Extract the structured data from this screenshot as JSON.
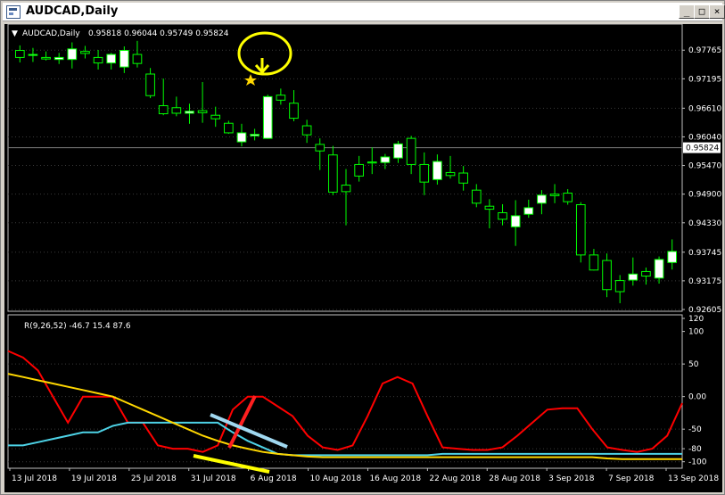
{
  "window": {
    "title": "AUDCAD,Daily",
    "buttons": {
      "minimize": "_",
      "maximize": "□",
      "close": "×"
    }
  },
  "colors": {
    "background": "#000000",
    "bull_candle": "#ffffff",
    "wick": "#00ff00",
    "grid": "#3a3a3a",
    "osc_red": "#ff0000",
    "osc_cyan": "#4dd2e6",
    "osc_yellow": "#ffd700",
    "annotation_yellow": "#ffff00",
    "annotation_red": "#ff2020",
    "annotation_lightblue": "#a0d8f0"
  },
  "chart_data": [
    {
      "type": "candlestick",
      "title": "AUDCAD,Daily",
      "ohlc_header": "0.95818 0.96044 0.95749 0.95824",
      "current_price": 0.95824,
      "current_price_label": "0.95824",
      "ylim": [
        0.92605,
        0.98
      ],
      "y_ticks": [
        "0.97765",
        "0.97195",
        "0.96610",
        "0.96040",
        "0.95470",
        "0.94900",
        "0.94330",
        "0.93745",
        "0.93175",
        "0.92605"
      ],
      "x_ticks": [
        "13 Jul 2018",
        "19 Jul 2018",
        "25 Jul 2018",
        "31 Jul 2018",
        "6 Aug 2018",
        "10 Aug 2018",
        "16 Aug 2018",
        "22 Aug 2018",
        "28 Aug 2018",
        "3 Sep 2018",
        "7 Sep 2018",
        "13 Sep 2018"
      ],
      "candles": [
        {
          "o": 0.9776,
          "h": 0.9786,
          "l": 0.9752,
          "c": 0.9762
        },
        {
          "o": 0.9766,
          "h": 0.9781,
          "l": 0.9753,
          "c": 0.9768
        },
        {
          "o": 0.9762,
          "h": 0.9774,
          "l": 0.9756,
          "c": 0.9759
        },
        {
          "o": 0.9758,
          "h": 0.9771,
          "l": 0.9749,
          "c": 0.9762
        },
        {
          "o": 0.9758,
          "h": 0.9792,
          "l": 0.974,
          "c": 0.9779
        },
        {
          "o": 0.9774,
          "h": 0.9785,
          "l": 0.976,
          "c": 0.977
        },
        {
          "o": 0.9762,
          "h": 0.9777,
          "l": 0.9738,
          "c": 0.9751
        },
        {
          "o": 0.9751,
          "h": 0.9771,
          "l": 0.9738,
          "c": 0.9768
        },
        {
          "o": 0.9743,
          "h": 0.9784,
          "l": 0.9731,
          "c": 0.9776
        },
        {
          "o": 0.9768,
          "h": 0.9795,
          "l": 0.9742,
          "c": 0.975
        },
        {
          "o": 0.9729,
          "h": 0.9741,
          "l": 0.9681,
          "c": 0.9686
        },
        {
          "o": 0.9666,
          "h": 0.972,
          "l": 0.9647,
          "c": 0.965
        },
        {
          "o": 0.9662,
          "h": 0.9684,
          "l": 0.9645,
          "c": 0.9651
        },
        {
          "o": 0.9651,
          "h": 0.967,
          "l": 0.963,
          "c": 0.9655
        },
        {
          "o": 0.9656,
          "h": 0.9713,
          "l": 0.9632,
          "c": 0.9652
        },
        {
          "o": 0.9647,
          "h": 0.9664,
          "l": 0.9624,
          "c": 0.964
        },
        {
          "o": 0.9631,
          "h": 0.9636,
          "l": 0.961,
          "c": 0.9612
        },
        {
          "o": 0.9594,
          "h": 0.963,
          "l": 0.9585,
          "c": 0.9612
        },
        {
          "o": 0.9606,
          "h": 0.962,
          "l": 0.9597,
          "c": 0.9609
        },
        {
          "o": 0.9601,
          "h": 0.9688,
          "l": 0.96,
          "c": 0.9684
        },
        {
          "o": 0.9687,
          "h": 0.97,
          "l": 0.9668,
          "c": 0.9677
        },
        {
          "o": 0.9671,
          "h": 0.9697,
          "l": 0.9635,
          "c": 0.9641
        },
        {
          "o": 0.9626,
          "h": 0.9638,
          "l": 0.9592,
          "c": 0.9608
        },
        {
          "o": 0.9589,
          "h": 0.9601,
          "l": 0.9538,
          "c": 0.9576
        },
        {
          "o": 0.9568,
          "h": 0.9586,
          "l": 0.9488,
          "c": 0.9494
        },
        {
          "o": 0.9508,
          "h": 0.954,
          "l": 0.9428,
          "c": 0.9495
        },
        {
          "o": 0.9549,
          "h": 0.9566,
          "l": 0.9515,
          "c": 0.9526
        },
        {
          "o": 0.9554,
          "h": 0.9583,
          "l": 0.953,
          "c": 0.9552
        },
        {
          "o": 0.9553,
          "h": 0.957,
          "l": 0.954,
          "c": 0.9564
        },
        {
          "o": 0.9562,
          "h": 0.9596,
          "l": 0.9552,
          "c": 0.959
        },
        {
          "o": 0.9601,
          "h": 0.9606,
          "l": 0.953,
          "c": 0.9549
        },
        {
          "o": 0.9549,
          "h": 0.9573,
          "l": 0.9488,
          "c": 0.9514
        },
        {
          "o": 0.9519,
          "h": 0.9569,
          "l": 0.9509,
          "c": 0.9555
        },
        {
          "o": 0.9533,
          "h": 0.9566,
          "l": 0.9521,
          "c": 0.9527
        },
        {
          "o": 0.9532,
          "h": 0.9546,
          "l": 0.9497,
          "c": 0.9512
        },
        {
          "o": 0.9498,
          "h": 0.951,
          "l": 0.9464,
          "c": 0.9472
        },
        {
          "o": 0.9466,
          "h": 0.948,
          "l": 0.9422,
          "c": 0.946
        },
        {
          "o": 0.9453,
          "h": 0.947,
          "l": 0.9428,
          "c": 0.944
        },
        {
          "o": 0.9425,
          "h": 0.9478,
          "l": 0.9387,
          "c": 0.9447
        },
        {
          "o": 0.945,
          "h": 0.9479,
          "l": 0.9443,
          "c": 0.9463
        },
        {
          "o": 0.9472,
          "h": 0.9498,
          "l": 0.945,
          "c": 0.9488
        },
        {
          "o": 0.949,
          "h": 0.951,
          "l": 0.9472,
          "c": 0.9487
        },
        {
          "o": 0.9492,
          "h": 0.95,
          "l": 0.9469,
          "c": 0.9475
        },
        {
          "o": 0.9469,
          "h": 0.9474,
          "l": 0.9354,
          "c": 0.9369
        },
        {
          "o": 0.9369,
          "h": 0.9381,
          "l": 0.9338,
          "c": 0.9339
        },
        {
          "o": 0.9358,
          "h": 0.9372,
          "l": 0.9285,
          "c": 0.93
        },
        {
          "o": 0.9318,
          "h": 0.9329,
          "l": 0.9273,
          "c": 0.9296
        },
        {
          "o": 0.9319,
          "h": 0.9364,
          "l": 0.9308,
          "c": 0.9331
        },
        {
          "o": 0.9336,
          "h": 0.9344,
          "l": 0.931,
          "c": 0.9327
        },
        {
          "o": 0.9323,
          "h": 0.9366,
          "l": 0.9312,
          "c": 0.936
        },
        {
          "o": 0.9354,
          "h": 0.94,
          "l": 0.934,
          "c": 0.9376
        }
      ]
    },
    {
      "type": "line",
      "title": "R(9,26,52) -46.7 15.4 87.6",
      "ylim": [
        -100,
        100
      ],
      "y_ticks": [
        "120",
        "100",
        "50",
        "0.00",
        "-50",
        "-80",
        "-100"
      ],
      "series": [
        {
          "color": "#ff0000",
          "values": [
            70,
            60,
            40,
            0,
            -40,
            0,
            0,
            0,
            -40,
            -40,
            -75,
            -80,
            -80,
            -85,
            -75,
            -20,
            0,
            0,
            -15,
            -30,
            -60,
            -78,
            -82,
            -75,
            -30,
            20,
            30,
            20,
            -30,
            -78,
            -80,
            -82,
            -82,
            -78,
            -60,
            -40,
            -20,
            -18,
            -18,
            -50,
            -78,
            -82,
            -85,
            -80,
            -60,
            -10
          ]
        },
        {
          "color": "#4dd2e6",
          "values": [
            -75,
            -75,
            -70,
            -65,
            -60,
            -55,
            -55,
            -45,
            -40,
            -40,
            -40,
            -40,
            -40,
            -40,
            -40,
            -55,
            -68,
            -78,
            -88,
            -90,
            -90,
            -90,
            -90,
            -90,
            -90,
            -90,
            -90,
            -90,
            -90,
            -88,
            -88,
            -88,
            -88,
            -88,
            -88,
            -88,
            -88,
            -88,
            -88,
            -88,
            -88,
            -88,
            -88,
            -88,
            -88,
            -88
          ]
        },
        {
          "color": "#ffd700",
          "values": [
            35,
            30,
            25,
            20,
            15,
            10,
            5,
            0,
            -10,
            -20,
            -30,
            -40,
            -50,
            -60,
            -68,
            -75,
            -80,
            -85,
            -88,
            -90,
            -92,
            -93,
            -93,
            -93,
            -93,
            -93,
            -93,
            -93,
            -93,
            -93,
            -93,
            -93,
            -93,
            -93,
            -93,
            -93,
            -93,
            -93,
            -93,
            -93,
            -95,
            -96,
            -96,
            -96,
            -96,
            -96
          ]
        }
      ]
    }
  ]
}
